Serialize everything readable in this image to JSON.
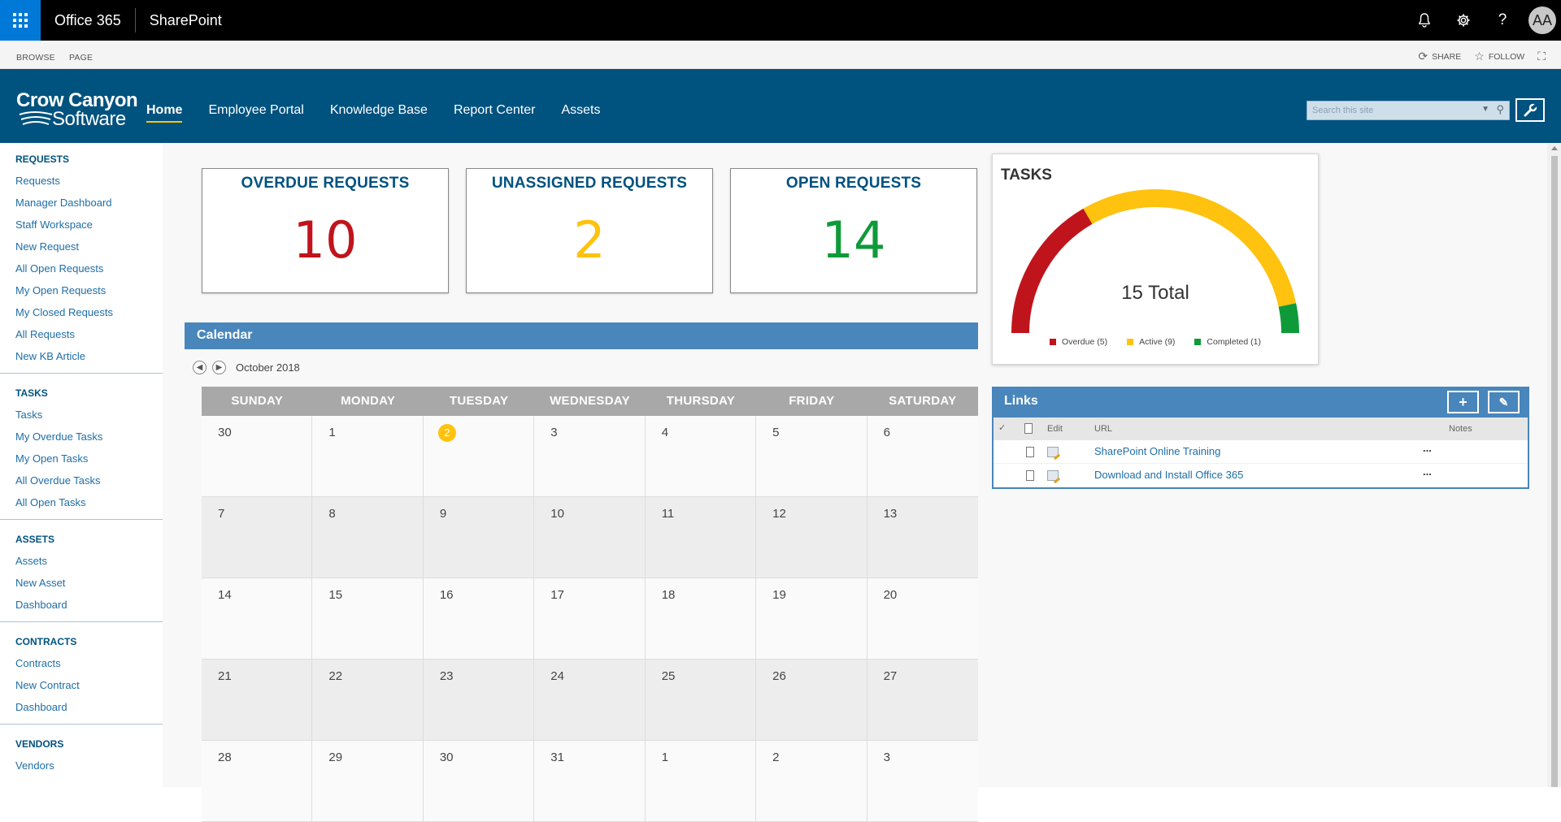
{
  "suite": {
    "app_launcher_icon": "waffle-icon",
    "office_label": "Office 365",
    "product_label": "SharePoint",
    "notifications_icon": "bell-icon",
    "settings_icon": "gear-icon",
    "help_icon": "question-icon",
    "avatar_initials": "AA"
  },
  "ribbon": {
    "tabs": [
      "BROWSE",
      "PAGE"
    ],
    "share_label": "SHARE",
    "follow_label": "FOLLOW"
  },
  "header": {
    "logo_line1": "Crow Canyon",
    "logo_line2": "Software",
    "nav": [
      "Home",
      "Employee Portal",
      "Knowledge Base",
      "Report Center",
      "Assets"
    ],
    "active_nav": "Home",
    "search_placeholder": "Search this site",
    "accent": "#ffc20e",
    "bar_color": "#00527f"
  },
  "leftnav": {
    "requests": {
      "heading": "REQUESTS",
      "items": [
        "Requests",
        "Manager Dashboard",
        "Staff Workspace",
        "New Request",
        "All Open Requests",
        "My Open Requests",
        "My Closed Requests",
        "All Requests",
        "New KB Article"
      ]
    },
    "tasks": {
      "heading": "TASKS",
      "items": [
        "Tasks",
        "My Overdue Tasks",
        "My Open Tasks",
        "All Overdue Tasks",
        "All Open Tasks"
      ]
    },
    "assets": {
      "heading": "ASSETS",
      "items": [
        "Assets",
        "New Asset",
        "Dashboard"
      ]
    },
    "contracts": {
      "heading": "CONTRACTS",
      "items": [
        "Contracts",
        "New Contract",
        "Dashboard"
      ]
    },
    "vendors": {
      "heading": "VENDORS",
      "items": [
        "Vendors"
      ]
    }
  },
  "kpis": [
    {
      "title": "OVERDUE REQUESTS",
      "value": "10",
      "color": "#c0141c"
    },
    {
      "title": "UNASSIGNED REQUESTS",
      "value": "2",
      "color": "#ffc20e"
    },
    {
      "title": "OPEN REQUESTS",
      "value": "14",
      "color": "#0f9a3a"
    }
  ],
  "tasks_gauge": {
    "title": "TASKS",
    "total_label": "15 Total",
    "legend": [
      {
        "label": "Overdue (5)",
        "color": "#c0141c",
        "count": 5
      },
      {
        "label": "Active (9)",
        "color": "#ffc20e",
        "count": 9
      },
      {
        "label": "Completed (1)",
        "color": "#0f9a3a",
        "count": 1
      }
    ]
  },
  "calendar": {
    "title": "Calendar",
    "month": "October 2018",
    "day_names": [
      "SUNDAY",
      "MONDAY",
      "TUESDAY",
      "WEDNESDAY",
      "THURSDAY",
      "FRIDAY",
      "SATURDAY"
    ],
    "weeks": [
      [
        "30",
        "1",
        "2",
        "3",
        "4",
        "5",
        "6"
      ],
      [
        "7",
        "8",
        "9",
        "10",
        "11",
        "12",
        "13"
      ],
      [
        "14",
        "15",
        "16",
        "17",
        "18",
        "19",
        "20"
      ],
      [
        "21",
        "22",
        "23",
        "24",
        "25",
        "26",
        "27"
      ],
      [
        "28",
        "29",
        "30",
        "31",
        "1",
        "2",
        "3"
      ]
    ],
    "today": "2"
  },
  "links": {
    "title": "Links",
    "add_icon": "plus-icon",
    "edit_icon": "pencil-icon",
    "columns": {
      "edit": "Edit",
      "url": "URL",
      "notes": "Notes"
    },
    "rows": [
      {
        "url": "SharePoint Online Training",
        "menu": "..."
      },
      {
        "url": "Download and Install Office 365",
        "menu": "..."
      }
    ]
  }
}
